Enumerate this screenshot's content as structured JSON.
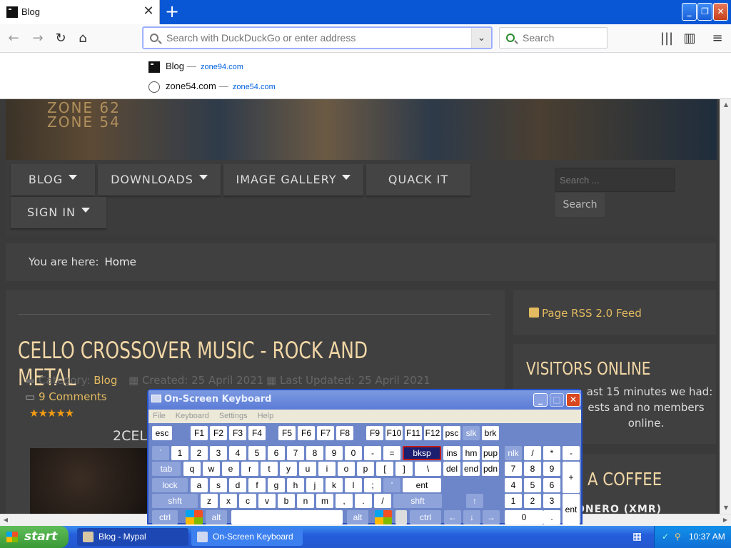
{
  "browser": {
    "tab_title": "Blog",
    "url_placeholder": "Search with DuckDuckGo or enter address",
    "search_placeholder": "Search",
    "suggestions": [
      {
        "title": "Blog",
        "url": "zone94.com"
      },
      {
        "title": "zone54.com",
        "url": "zone54.com"
      }
    ]
  },
  "site": {
    "banner_logo_line1": "ZONE 62",
    "banner_logo_line2": "ZONE 54",
    "menu": [
      "BLOG",
      "DOWNLOADS",
      "IMAGE GALLERY",
      "QUACK IT",
      "SIGN IN"
    ],
    "search_placeholder": "Search ...",
    "search_button": "Search",
    "breadcrumb_label": "You are here:",
    "breadcrumb_current": "Home",
    "article": {
      "title": "CELLO CROSSOVER MUSIC - ROCK AND METAL",
      "category_label": "Category:",
      "category": "Blog",
      "created": "Created: 25 April 2021",
      "updated": "Last Updated: 25 April 2021",
      "comments": "9 Comments",
      "rating": 5,
      "subtitle": "2CELL"
    },
    "sidebar": {
      "rss": "Page RSS 2.0 Feed",
      "visitors_title": "VISITORS ONLINE",
      "visitors_text_1": "ast 15 minutes we had:",
      "visitors_text_2": "ests and no members",
      "visitors_text_3": "online.",
      "coffee_title": "A COFFEE",
      "coffee_sub": "ONERO (XMR)"
    }
  },
  "osk": {
    "title": "On-Screen Keyboard",
    "menu": [
      "File",
      "Keyboard",
      "Settings",
      "Help"
    ],
    "rows": [
      [
        "esc",
        "F1",
        "F2",
        "F3",
        "F4",
        "F5",
        "F6",
        "F7",
        "F8",
        "F9",
        "F10",
        "F11",
        "F12",
        "psc",
        "slk",
        "brk"
      ],
      [
        "`",
        "1",
        "2",
        "3",
        "4",
        "5",
        "6",
        "7",
        "8",
        "9",
        "0",
        "-",
        "=",
        "bksp",
        "ins",
        "hm",
        "pup",
        "nlk",
        "/",
        "*",
        "-"
      ],
      [
        "tab",
        "q",
        "w",
        "e",
        "r",
        "t",
        "y",
        "u",
        "i",
        "o",
        "p",
        "[",
        "]",
        "\\",
        "del",
        "end",
        "pdn",
        "7",
        "8",
        "9",
        "+"
      ],
      [
        "lock",
        "a",
        "s",
        "d",
        "f",
        "g",
        "h",
        "j",
        "k",
        "l",
        ";",
        "'",
        "ent",
        "4",
        "5",
        "6"
      ],
      [
        "shft",
        "z",
        "x",
        "c",
        "v",
        "b",
        "n",
        "m",
        ",",
        ".",
        "/",
        "shft",
        "↑",
        "1",
        "2",
        "3",
        "ent"
      ],
      [
        "ctrl",
        "alt",
        "alt",
        "ctrl",
        "←",
        "↓",
        "→",
        "0",
        "."
      ]
    ]
  },
  "taskbar": {
    "start": "start",
    "tasks": [
      "Blog - Mypal",
      "On-Screen Keyboard"
    ],
    "clock": "10:37 AM"
  },
  "colors": {
    "accent": "#e4bb60",
    "heading": "#f1d6a5",
    "taskbar": "#245edb"
  }
}
